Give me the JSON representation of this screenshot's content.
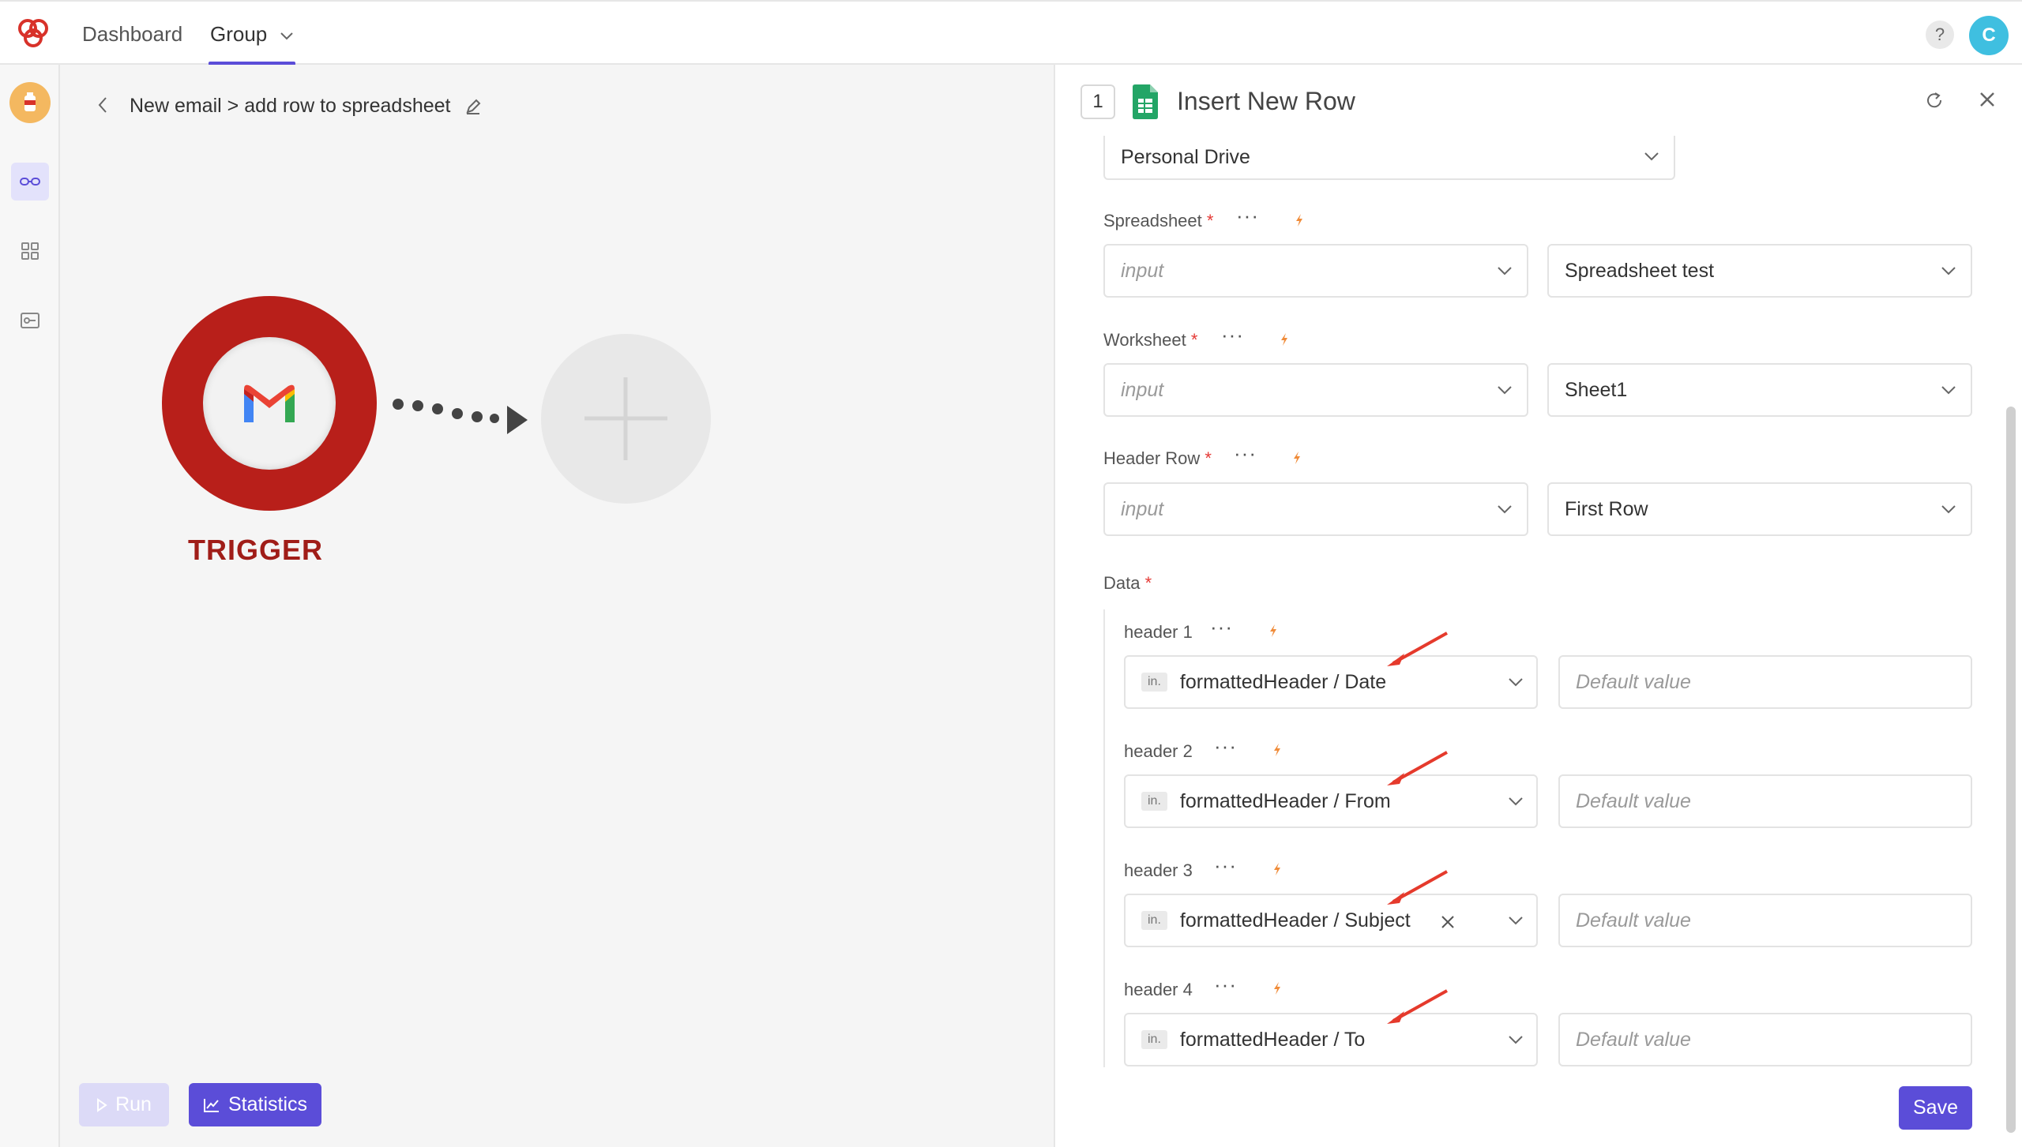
{
  "topbar": {
    "nav_dashboard": "Dashboard",
    "nav_group": "Group",
    "help": "?",
    "avatar_letter": "C"
  },
  "canvas": {
    "breadcrumb": "New email > add row to spreadsheet",
    "trigger_label": "TRIGGER",
    "run_label": "Run",
    "statistics_label": "Statistics"
  },
  "panel": {
    "step_number": "1",
    "title": "Insert New Row",
    "drive_value": "Personal Drive",
    "fields": [
      {
        "label": "Spreadsheet",
        "input_placeholder": "input",
        "value": "Spreadsheet test"
      },
      {
        "label": "Worksheet",
        "input_placeholder": "input",
        "value": "Sheet1"
      },
      {
        "label": "Header Row",
        "input_placeholder": "input",
        "value": "First Row"
      }
    ],
    "data_label": "Data",
    "data_rows": [
      {
        "label": "header 1",
        "tag": "in.",
        "value": "formattedHeader / Date",
        "default_placeholder": "Default value"
      },
      {
        "label": "header 2",
        "tag": "in.",
        "value": "formattedHeader / From",
        "default_placeholder": "Default value"
      },
      {
        "label": "header 3",
        "tag": "in.",
        "value": "formattedHeader / Subject",
        "default_placeholder": "Default value"
      },
      {
        "label": "header 4",
        "tag": "in.",
        "value": "formattedHeader / To",
        "default_placeholder": "Default value"
      }
    ],
    "save_label": "Save"
  },
  "colors": {
    "accent": "#5b4dd8",
    "trigger_red": "#b81f1a",
    "annotation_arrow": "#e53a2c",
    "bolt_orange": "#f08c3a"
  }
}
